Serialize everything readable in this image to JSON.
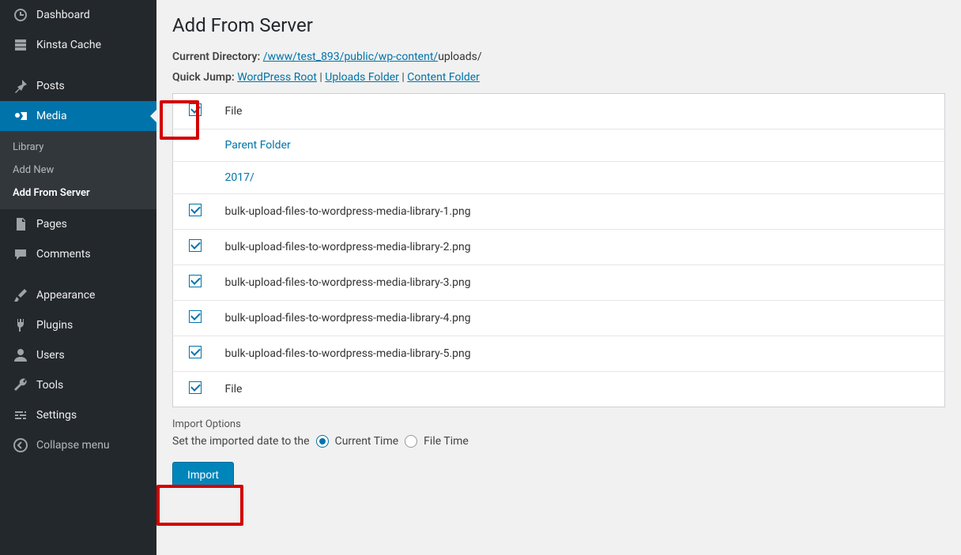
{
  "sidebar": {
    "items": [
      {
        "label": "Dashboard"
      },
      {
        "label": "Kinsta Cache"
      },
      {
        "label": "Posts"
      },
      {
        "label": "Media",
        "active": true,
        "sub": [
          {
            "label": "Library"
          },
          {
            "label": "Add New"
          },
          {
            "label": "Add From Server",
            "current": true
          }
        ]
      },
      {
        "label": "Pages"
      },
      {
        "label": "Comments"
      },
      {
        "label": "Appearance"
      },
      {
        "label": "Plugins"
      },
      {
        "label": "Users"
      },
      {
        "label": "Tools"
      },
      {
        "label": "Settings"
      }
    ],
    "collapse_label": "Collapse menu"
  },
  "page": {
    "title": "Add From Server",
    "current_dir_label": "Current Directory:",
    "current_dir_link": "/www/test_893/public/wp-content/",
    "current_dir_suffix": "uploads/",
    "quick_jump_label": "Quick Jump:",
    "quick_jump_links": [
      "WordPress Root",
      "Uploads Folder",
      "Content Folder"
    ],
    "file_header": "File",
    "rows": [
      {
        "type": "link",
        "label": "Parent Folder"
      },
      {
        "type": "link",
        "label": "2017/"
      },
      {
        "type": "file",
        "label": "bulk-upload-files-to-wordpress-media-library-1.png"
      },
      {
        "type": "file",
        "label": "bulk-upload-files-to-wordpress-media-library-2.png"
      },
      {
        "type": "file",
        "label": "bulk-upload-files-to-wordpress-media-library-3.png"
      },
      {
        "type": "file",
        "label": "bulk-upload-files-to-wordpress-media-library-4.png"
      },
      {
        "type": "file",
        "label": "bulk-upload-files-to-wordpress-media-library-5.png"
      }
    ],
    "import_options_label": "Import Options",
    "date_prompt": "Set the imported date to the",
    "radio_current": "Current Time",
    "radio_file": "File Time",
    "import_btn": "Import"
  }
}
